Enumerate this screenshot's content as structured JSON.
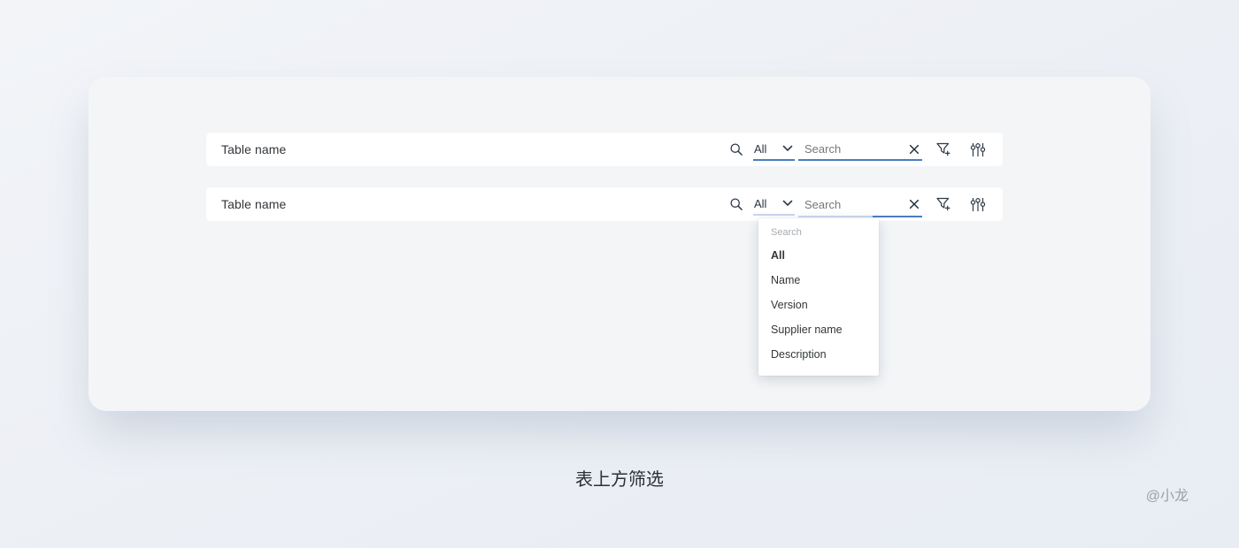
{
  "page": {
    "caption": "表上方筛选",
    "watermark": "@小龙"
  },
  "toolbars": [
    {
      "title": "Table name",
      "filter_select": "All",
      "search_placeholder": "Search"
    },
    {
      "title": "Table name",
      "filter_select": "All",
      "search_placeholder": "Search"
    }
  ],
  "dropdown": {
    "search_placeholder": "Search",
    "selected": "All",
    "items": [
      "All",
      "Name",
      "Version",
      "Supplier name",
      "Description"
    ]
  },
  "icons": {
    "search": "magnifier-icon",
    "select_arrow": "chevron-down-icon",
    "clear": "x-clear-icon",
    "add_filter": "funnel-plus-icon",
    "settings": "sliders-icon"
  },
  "colors": {
    "underline_active": "#4a7dc0",
    "underline_muted": "#c9d7ee",
    "toolbar_bg": "#ffffff",
    "card_bg": "#f3f5f7",
    "page_bg": "#edf1f6",
    "text_primary": "#32363a",
    "text_placeholder": "#74777a",
    "icon": "#2f3b47"
  }
}
